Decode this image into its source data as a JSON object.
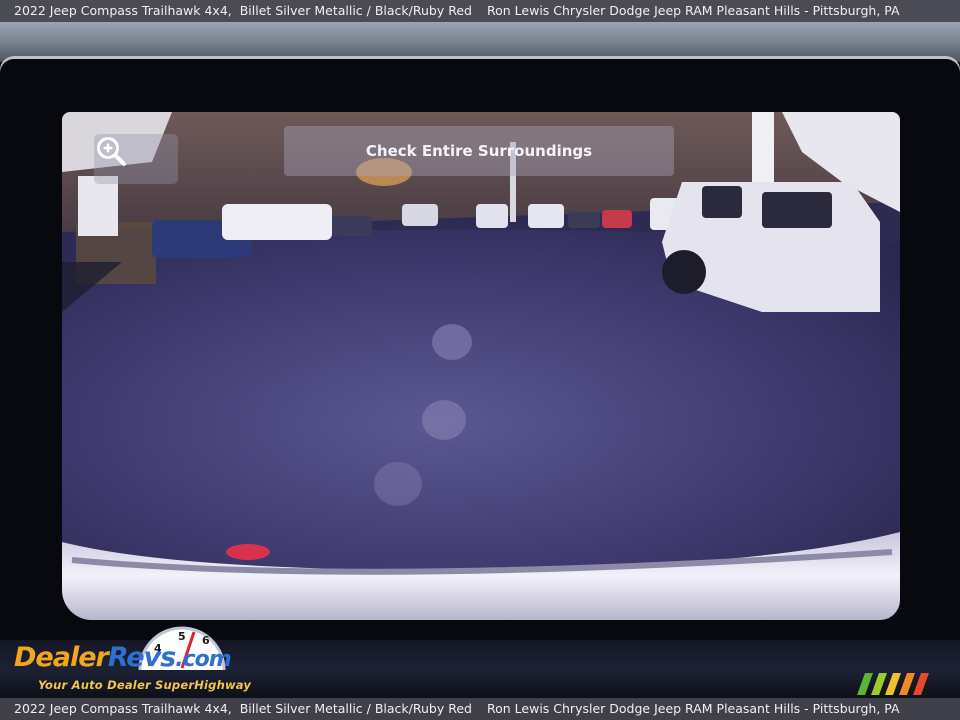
{
  "caption": {
    "vehicle": "2022 Jeep Compass Trailhawk 4x4,",
    "color": "Billet Silver Metallic / Black/Ruby Red",
    "dealer": "Ron Lewis Chrysler Dodge Jeep RAM Pleasant Hills - Pittsburgh, PA"
  },
  "camera_screen": {
    "banner_text": "Check Entire Surroundings",
    "zoom_icon": "zoom-in-icon"
  },
  "watermark": {
    "brand_dealer": "Dealer",
    "brand_revs": "Revs",
    "brand_com": ".com",
    "tagline": "Your Auto Dealer SuperHighway",
    "gauge_numbers": "4 5 6"
  },
  "colors": {
    "logo_orange": "#f2a51e",
    "logo_blue": "#2f6fd0",
    "caption_bg": "#4a4b55"
  }
}
